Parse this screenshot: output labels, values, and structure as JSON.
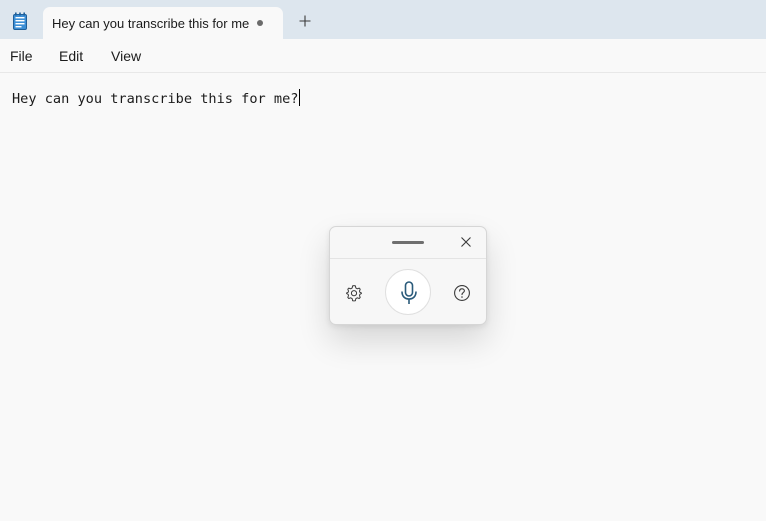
{
  "tab": {
    "title": "Hey can you transcribe this for me"
  },
  "menu": {
    "items": [
      "File",
      "Edit",
      "View"
    ]
  },
  "editor": {
    "content": "Hey can you transcribe this for me?"
  },
  "voice_typing": {
    "icons": [
      "settings-icon",
      "microphone-icon",
      "help-icon",
      "close-icon",
      "drag-handle"
    ]
  },
  "colors": {
    "titlebar": "#dde6ee",
    "background": "#f9f9f9",
    "mic_accent": "#2a5a7a"
  }
}
